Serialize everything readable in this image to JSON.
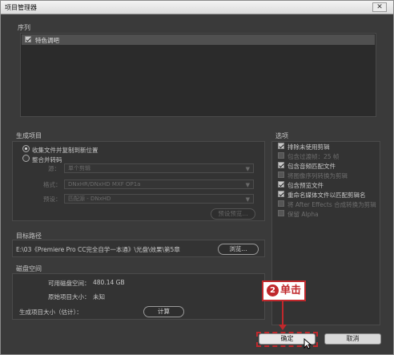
{
  "window": {
    "title": "项目管理器",
    "close_glyph": "✕"
  },
  "sequence": {
    "label": "序列",
    "items": [
      {
        "label": "特色调吧",
        "checked": true
      }
    ]
  },
  "output": {
    "label": "生成项目",
    "radio_collect": "收集文件并复制到新位置",
    "radio_consolidate": "整合并转码",
    "source_label": "源：",
    "source_value": "单个剪辑",
    "format_label": "格式：",
    "format_value": "DNxHR/DNxHD MXF OP1a",
    "preset_label": "预设：",
    "preset_value": "匹配源 - DNxHD",
    "preset_button": "预设预览..."
  },
  "options": {
    "label": "选项",
    "items": [
      {
        "label": "排除未使用剪辑",
        "checked": true,
        "enabled": true
      },
      {
        "label": "包含过渡帧：25 帧",
        "checked": false,
        "enabled": false
      },
      {
        "label": "包含音频匹配文件",
        "checked": true,
        "enabled": true
      },
      {
        "label": "将图像序列转换为剪辑",
        "checked": false,
        "enabled": false
      },
      {
        "label": "包含预览文件",
        "checked": true,
        "enabled": true
      },
      {
        "label": "重命名媒体文件以匹配剪辑名",
        "checked": true,
        "enabled": true
      },
      {
        "label": "将 After Effects 合成转换为剪辑",
        "checked": false,
        "enabled": false
      },
      {
        "label": "保留 Alpha",
        "checked": false,
        "enabled": false
      }
    ]
  },
  "destination": {
    "label": "目标路径",
    "path": "E:\\03《Premiere Pro CC完全自学一本通》\\光盘\\效果\\第5章",
    "browse_button": "浏览..."
  },
  "disk": {
    "label": "磁盘空间",
    "available_label": "可用磁盘空间：",
    "available_value": "480.14 GB",
    "original_label": "原始项目大小：",
    "original_value": "未知",
    "generated_label": "生成项目大小（估计）：",
    "calc_button": "计算"
  },
  "footer": {
    "ok_button": "确定",
    "cancel_button": "取消"
  },
  "annotation": {
    "step_number": "2",
    "step_text": "单击",
    "color": "#c0282c"
  }
}
